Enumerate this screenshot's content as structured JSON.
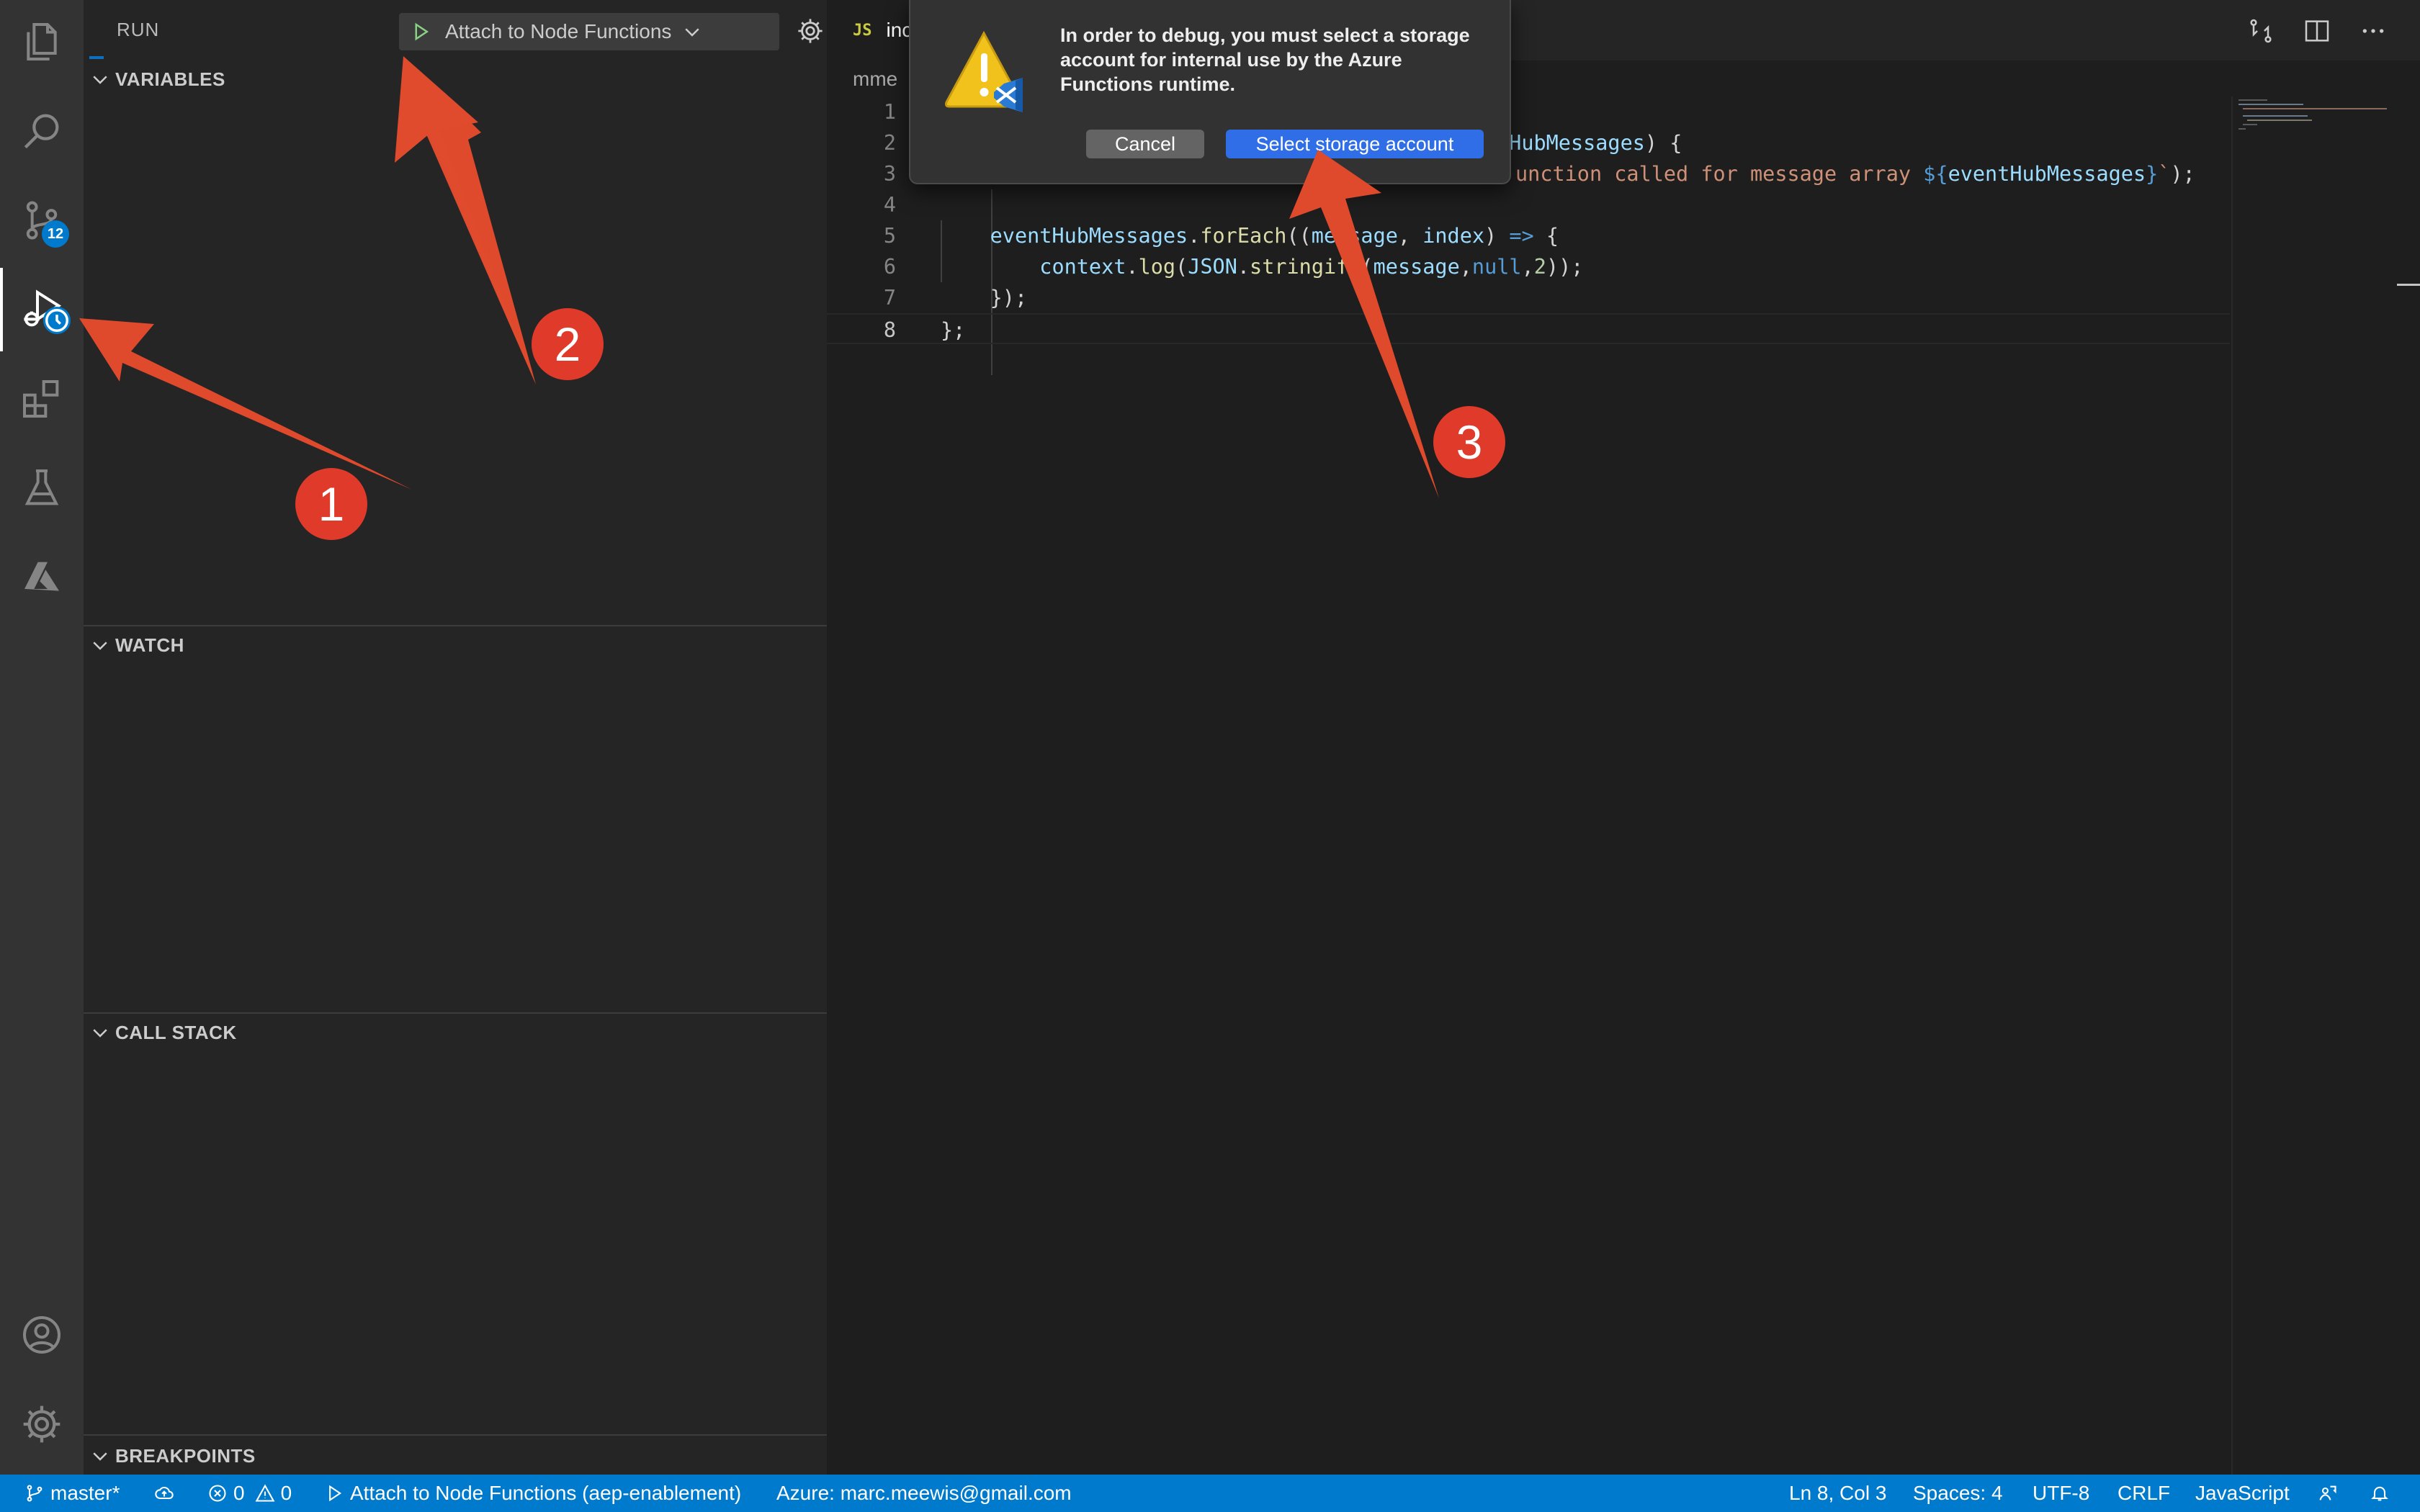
{
  "sidebar": {
    "title": "RUN",
    "debug_config": "Attach to Node Functions",
    "sections": {
      "variables": "VARIABLES",
      "watch": "WATCH",
      "call_stack": "CALL STACK",
      "breakpoints": "BREAKPOINTS"
    }
  },
  "activity_bar": {
    "source_control_badge": "12",
    "icons": [
      "files-icon",
      "search-icon",
      "source-control-icon",
      "run-debug-icon",
      "extensions-icon",
      "testing-icon",
      "azure-icon",
      "account-icon",
      "settings-gear-icon"
    ]
  },
  "editor": {
    "tab": {
      "type": "JS",
      "label": "inc"
    },
    "breadcrumb": "mme",
    "lines": [
      {
        "n": "1",
        "code": ""
      },
      {
        "n": "2",
        "code": "tHubMessages) {"
      },
      {
        "n": "3",
        "code": "unction called for message array ${eventHubMessages}`);"
      },
      {
        "n": "4",
        "code": ""
      },
      {
        "n": "5",
        "code": "    eventHubMessages.forEach((message, index) => {"
      },
      {
        "n": "6",
        "code": "        context.log(JSON.stringify(message,null,2));"
      },
      {
        "n": "7",
        "code": "    });"
      },
      {
        "n": "8",
        "code": "};"
      }
    ]
  },
  "dialog": {
    "message": "In order to debug, you must select a storage account for internal use by the Azure Functions runtime.",
    "cancel": "Cancel",
    "primary": "Select storage account"
  },
  "annotations": [
    "1",
    "2",
    "3"
  ],
  "statusbar": {
    "branch": "master*",
    "errors": "0",
    "warnings": "0",
    "debug": "Attach to Node Functions (aep-enablement)",
    "azure": "Azure: marc.meewis@gmail.com",
    "position": "Ln 8, Col 3",
    "spaces": "Spaces: 4",
    "encoding": "UTF-8",
    "eol": "CRLF",
    "language": "JavaScript"
  },
  "colors": {
    "accent": "#007acc",
    "annotation_red": "#e03a2b",
    "dialog_primary": "#2f6ee6"
  }
}
